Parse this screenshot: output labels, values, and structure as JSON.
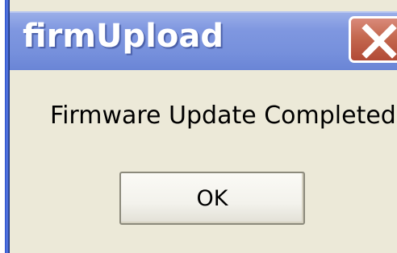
{
  "window": {
    "title": "firmUpload",
    "close_icon": "close-icon",
    "title_bar_color": "#7f97e0",
    "close_button_color": "#c4684f",
    "dialog_background": "#ece9d8"
  },
  "dialog": {
    "message": "Firmware Update Completed.",
    "ok_label": "OK"
  }
}
